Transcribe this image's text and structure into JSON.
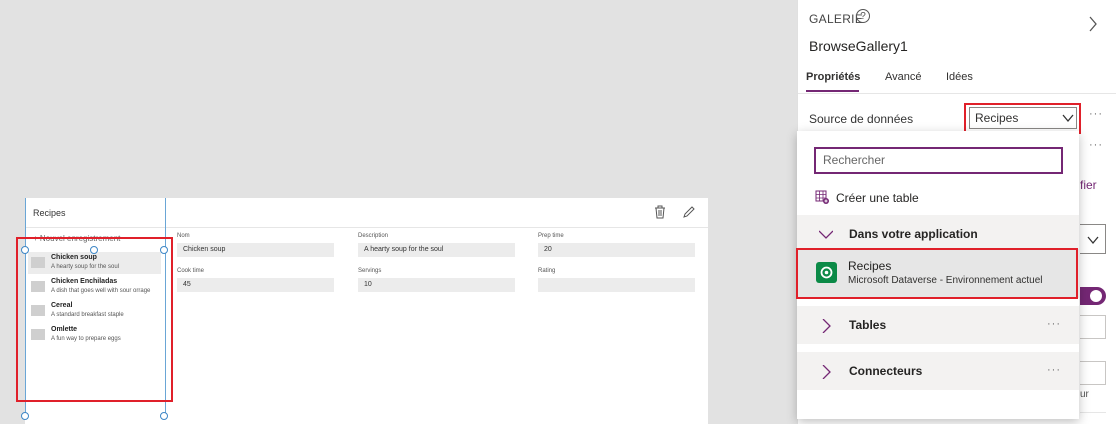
{
  "app_screen": {
    "title": "Recipes",
    "new_record": "Nouvel enregistrement",
    "gallery_items": [
      {
        "name": "Chicken soup",
        "desc": "A hearty soup for the soul",
        "selected": true
      },
      {
        "name": "Chicken Enchiladas",
        "desc": "A dish that goes well with sour orrage"
      },
      {
        "name": "Cereal",
        "desc": "A standard breakfast staple"
      },
      {
        "name": "Omlette",
        "desc": "A fun way to prepare eggs"
      }
    ],
    "form": {
      "nom_label": "Nom",
      "nom_value": "Chicken soup",
      "desc_label": "Description",
      "desc_value": "A hearty soup for the soul",
      "prep_label": "Prep time",
      "prep_value": "20",
      "cook_label": "Cook time",
      "cook_value": "45",
      "serv_label": "Servings",
      "serv_value": "10",
      "rating_label": "Rating",
      "rating_value": ""
    }
  },
  "pane": {
    "kind": "GALERIE",
    "help": "?",
    "control_name": "BrowseGallery1",
    "tabs": [
      "Propriétés",
      "Avancé",
      "Idées"
    ],
    "source_label": "Source de données",
    "source_value": "Recipes",
    "more": "···",
    "partial_text_1": "fier",
    "partial_text_2": "ur"
  },
  "flyout": {
    "search_placeholder": "Rechercher",
    "create_table": "Créer une table",
    "section_app": "Dans votre application",
    "recipe_name": "Recipes",
    "recipe_sub": "Microsoft Dataverse - Environnement actuel",
    "section_tables": "Tables",
    "section_connectors": "Connecteurs",
    "more": "···"
  },
  "colors": {
    "accent": "#742774",
    "highlight": "#e0202a",
    "dataverse": "#0b8a47"
  }
}
